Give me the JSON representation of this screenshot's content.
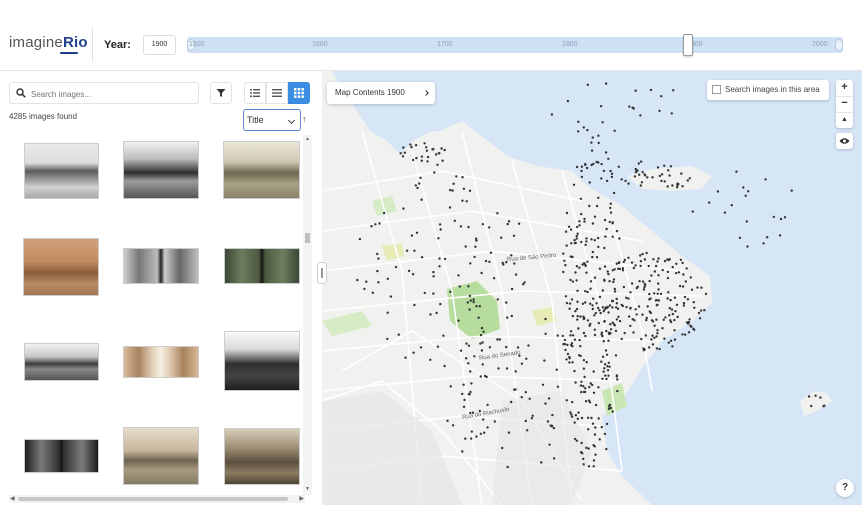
{
  "header": {
    "logo_text_a": "imagine",
    "logo_text_b": "Rio",
    "year_label": "Year:",
    "year_value": "1900",
    "slider_ticks": [
      "1500",
      "1600",
      "1700",
      "1800",
      "1900",
      "2000"
    ],
    "slider_value": 1900,
    "slider_min": 1500,
    "slider_max": 2020
  },
  "sidebar": {
    "search_placeholder": "Search images...",
    "results_count": "4285 images found",
    "sort_value": "Title",
    "sort_direction_icon": "↑"
  },
  "map": {
    "contents_label": "Map Contents 1900",
    "search_area_label": "Search images in this area",
    "zoom_in": "+",
    "zoom_out": "−",
    "compass": "▲",
    "help": "?",
    "road_labels": [
      "Rua do Senado",
      "Rua do Riachuelo",
      "Rua de São Pedro"
    ]
  },
  "colors": {
    "accent": "#3a8de0",
    "brand": "#1f3f8a",
    "water": "#d6e6f7",
    "land": "#f1f1f0",
    "park": "#b6dc9e"
  },
  "icons": [
    "search-icon",
    "filter-icon",
    "list-detail-icon",
    "list-icon",
    "grid-icon",
    "chevron-down-icon",
    "sort-arrow-icon",
    "chevron-right-icon",
    "eye-icon",
    "compass-icon"
  ]
}
